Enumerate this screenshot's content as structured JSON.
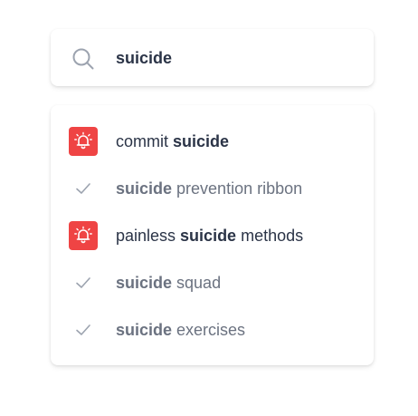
{
  "search": {
    "query": "suicide",
    "icon": "search-icon"
  },
  "colors": {
    "alert_bg": "#ef4444",
    "text_dark": "#2b3447",
    "text_muted": "#6b7280"
  },
  "suggestions": [
    {
      "type": "alert",
      "icon": "bell-alert-icon",
      "before": "commit ",
      "bold": "suicide",
      "after": ""
    },
    {
      "type": "check",
      "icon": "check-icon",
      "before": "",
      "bold": "suicide",
      "after": " prevention ribbon"
    },
    {
      "type": "alert",
      "icon": "bell-alert-icon",
      "before": "painless ",
      "bold": "suicide",
      "after": " methods"
    },
    {
      "type": "check",
      "icon": "check-icon",
      "before": "",
      "bold": "suicide",
      "after": " squad"
    },
    {
      "type": "check",
      "icon": "check-icon",
      "before": "",
      "bold": "suicide",
      "after": " exercises"
    }
  ]
}
